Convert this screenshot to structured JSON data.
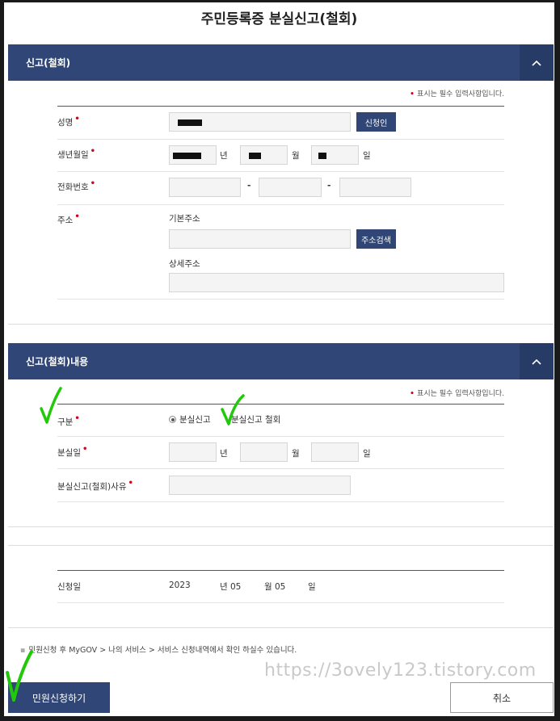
{
  "page": {
    "title": "주민등록증 분실신고(철회)"
  },
  "section1": {
    "title": "신고(철회)",
    "required_note": "표시는 필수 입력사항입니다.",
    "fields": {
      "name": {
        "label": "성명",
        "button": "신청인"
      },
      "birth": {
        "label": "생년월일",
        "unit_year": "년",
        "unit_month": "월",
        "unit_day": "일"
      },
      "phone": {
        "label": "전화번호",
        "dash": "-"
      },
      "address": {
        "label": "주소",
        "basic_label": "기본주소",
        "search_button": "주소검색",
        "detail_label": "상세주소"
      }
    }
  },
  "section2": {
    "title": "신고(철회)내용",
    "required_note": "표시는 필수 입력사항입니다.",
    "fields": {
      "type": {
        "label": "구분",
        "option1": "분실신고",
        "option2": "분실신고 철회"
      },
      "lost_date": {
        "label": "분실일",
        "unit_year": "년",
        "unit_month": "월",
        "unit_day": "일"
      },
      "reason": {
        "label": "분실신고(철회)사유"
      }
    }
  },
  "apply": {
    "label": "신청일",
    "year": "2023",
    "month_text": "년 05",
    "day_text": "월 05",
    "day_unit": "일"
  },
  "footer": {
    "note": "민원신청 후 MyGOV > 나의 서비스 > 서비스 신청내역에서 확인 하실수 있습니다.",
    "submit": "민원신청하기",
    "cancel": "취소"
  },
  "watermark": "https://3ovely123.tistory.com",
  "colors": {
    "primary": "#2f4677",
    "required": "#d0021b",
    "check": "#22c80a"
  }
}
